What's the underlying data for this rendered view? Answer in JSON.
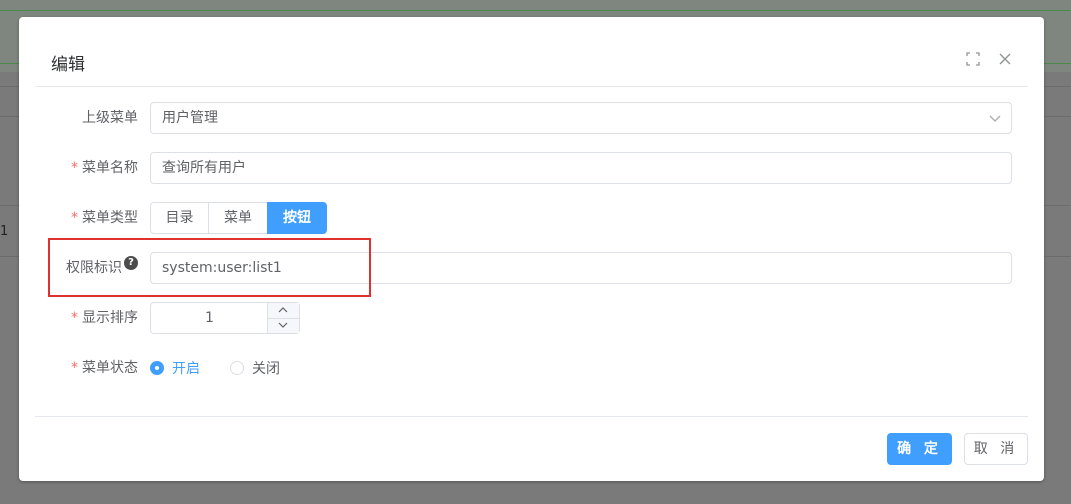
{
  "background": {
    "row_text": "1"
  },
  "dialog": {
    "title": "编辑",
    "fullscreen_icon": "fullscreen-icon",
    "close_icon": "close-icon"
  },
  "form": {
    "parent_menu": {
      "label": "上级菜单",
      "value": "用户管理"
    },
    "menu_name": {
      "label": "菜单名称",
      "value": "查询所有用户",
      "required": true
    },
    "menu_type": {
      "label": "菜单类型",
      "required": true,
      "options": [
        "目录",
        "菜单",
        "按钮"
      ],
      "selected": "按钮"
    },
    "permission": {
      "label": "权限标识",
      "help_icon": "?",
      "value": "system:user:list1"
    },
    "sort_order": {
      "label": "显示排序",
      "value": "1",
      "required": true
    },
    "menu_status": {
      "label": "菜单状态",
      "required": true,
      "options": [
        "开启",
        "关闭"
      ],
      "selected": "开启"
    }
  },
  "footer": {
    "confirm_label": "确 定",
    "cancel_label": "取 消"
  },
  "colors": {
    "primary": "#409eff",
    "required": "#f56c6c",
    "highlight": "#e03131"
  }
}
